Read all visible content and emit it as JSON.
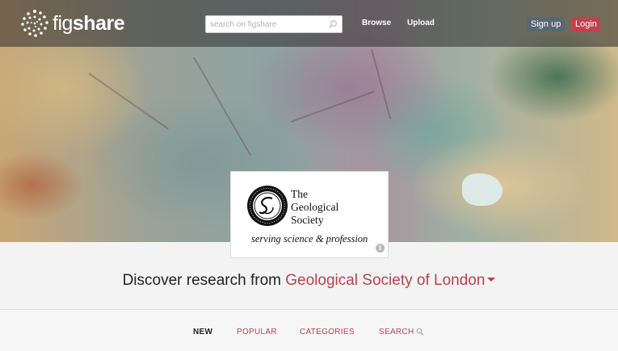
{
  "header": {
    "logo_text_light": "fig",
    "logo_text_bold": "share",
    "search_placeholder": "search on figshare",
    "nav": {
      "browse": "Browse",
      "upload": "Upload"
    },
    "signup_label": "Sign up",
    "login_label": "Login"
  },
  "institution": {
    "name_lines": [
      "The",
      "Geological",
      "Society"
    ],
    "tagline": "serving science & profession",
    "info_glyph": "i"
  },
  "discover": {
    "prefix": "Discover research from ",
    "institution_name": "Geological Society of London"
  },
  "tabs": [
    {
      "label": "NEW",
      "active": true
    },
    {
      "label": "POPULAR",
      "active": false
    },
    {
      "label": "CATEGORIES",
      "active": false
    },
    {
      "label": "SEARCH",
      "active": false
    }
  ],
  "colors": {
    "accent": "#b4434f",
    "login_bg": "#c2404f",
    "signup_bg": "#596772"
  }
}
